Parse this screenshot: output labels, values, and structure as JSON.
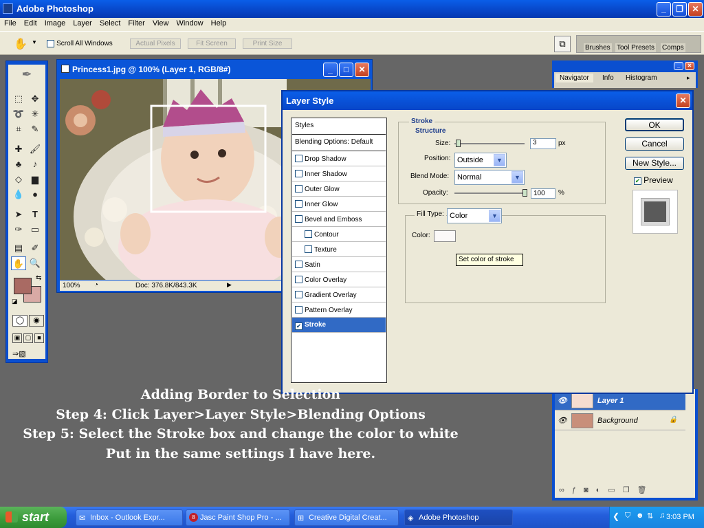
{
  "app": {
    "title": "Adobe Photoshop"
  },
  "menu": [
    "File",
    "Edit",
    "Image",
    "Layer",
    "Select",
    "Filter",
    "View",
    "Window",
    "Help"
  ],
  "options": {
    "scroll_all_windows": "Scroll All Windows",
    "actual_pixels": "Actual Pixels",
    "fit_screen": "Fit Screen",
    "print_size": "Print Size",
    "palette_tabs": [
      "Brushes",
      "Tool Presets",
      "Comps"
    ]
  },
  "document": {
    "title": "Princess1.jpg @ 100% (Layer 1, RGB/8#)",
    "zoom": "100%",
    "doc_size": "Doc: 376.8K/843.3K"
  },
  "navigator": {
    "tabs": [
      "Navigator",
      "Info",
      "Histogram"
    ]
  },
  "dialog": {
    "title": "Layer Style",
    "styles_header": "Styles",
    "blending": "Blending Options: Default",
    "effects": [
      {
        "label": "Drop Shadow",
        "checked": false,
        "indent": false
      },
      {
        "label": "Inner Shadow",
        "checked": false,
        "indent": false
      },
      {
        "label": "Outer Glow",
        "checked": false,
        "indent": false
      },
      {
        "label": "Inner Glow",
        "checked": false,
        "indent": false
      },
      {
        "label": "Bevel and Emboss",
        "checked": false,
        "indent": false
      },
      {
        "label": "Contour",
        "checked": false,
        "indent": true
      },
      {
        "label": "Texture",
        "checked": false,
        "indent": true
      },
      {
        "label": "Satin",
        "checked": false,
        "indent": false
      },
      {
        "label": "Color Overlay",
        "checked": false,
        "indent": false
      },
      {
        "label": "Gradient Overlay",
        "checked": false,
        "indent": false
      },
      {
        "label": "Pattern Overlay",
        "checked": false,
        "indent": false
      },
      {
        "label": "Stroke",
        "checked": true,
        "indent": false,
        "selected": true
      }
    ],
    "stroke_title": "Stroke",
    "structure_title": "Structure",
    "size_label": "Size:",
    "size_value": "3",
    "size_unit": "px",
    "position_label": "Position:",
    "position_value": "Outside",
    "blend_label": "Blend Mode:",
    "blend_value": "Normal",
    "opacity_label": "Opacity:",
    "opacity_value": "100",
    "opacity_unit": "%",
    "fill_type_label": "Fill Type:",
    "fill_type_value": "Color",
    "color_label": "Color:",
    "tooltip": "Set color of stroke",
    "ok": "OK",
    "cancel": "Cancel",
    "new_style": "New Style...",
    "preview": "Preview",
    "preview_checked": true
  },
  "layers": [
    {
      "name": "Layer 1",
      "selected": true
    },
    {
      "name": "Background",
      "selected": false
    }
  ],
  "caption": [
    "Adding Border to Selection",
    "Step 4: Click Layer>Layer Style>Blending Options",
    "Step 5: Select the Stroke box and change the color to white",
    "Put in the same settings I have here."
  ],
  "taskbar": {
    "start": "start",
    "tasks": [
      "Inbox - Outlook Expr...",
      "Jasc Paint Shop Pro - ...",
      "Creative Digital Creat...",
      "Adobe Photoshop"
    ],
    "badge": "8",
    "clock": "3:03 PM"
  },
  "colors": {
    "foreground": "#a96a63",
    "background": "#d9aaa5",
    "xp_blue": "#0a55d8",
    "selection": "#316ac5"
  }
}
